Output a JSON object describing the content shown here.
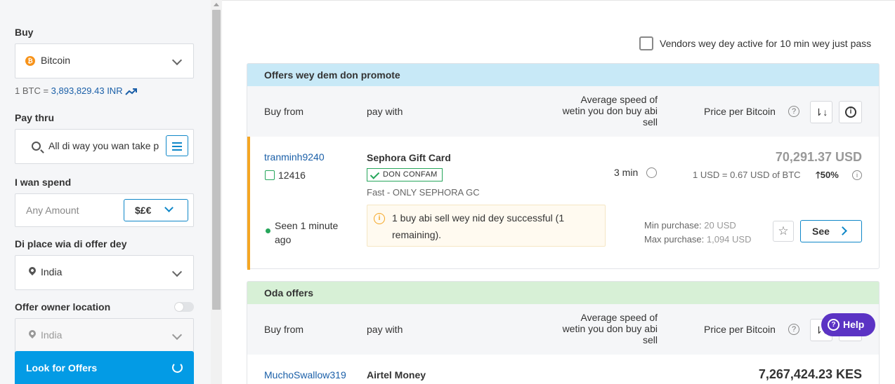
{
  "sidebar": {
    "buy_label": "Buy",
    "crypto": "Bitcoin",
    "crypto_icon": "bitcoin-icon",
    "rate_prefix": "1 BTC = ",
    "rate_value": "3,893,829.43 INR",
    "pay_label": "Pay thru",
    "pay_placeholder": "All di way you wan take p",
    "spend_label": "I wan spend",
    "amount_placeholder": "Any Amount",
    "currency_btn": "$£€",
    "location_label": "Di place wia di offer dey",
    "location_value": "India",
    "owner_location_label": "Offer owner location",
    "owner_location_value": "India",
    "look_button": "Look for Offers"
  },
  "main": {
    "active_checkbox_label": "Vendors wey dey active for 10 min wey just pass",
    "promoted": {
      "title": "Offers wey dem don promote",
      "columns": {
        "buy_from": "Buy from",
        "pay_with": "pay with",
        "speed": "Average speed of wetin you don buy abi sell",
        "price": "Price per Bitcoin"
      },
      "offer": {
        "user": "tranminh9240",
        "reputation": "12416",
        "method": "Sephora Gift Card",
        "badge": "DON CONFAM",
        "description": "Fast - ONLY SEPHORA GC",
        "speed": "3 min",
        "price": "70,291.37 USD",
        "conversion": "1 USD = 0.67 USD of BTC",
        "percent": "50%",
        "seen": "Seen 1 minute ago",
        "note": "1 buy abi sell wey nid dey successful (1 remaining).",
        "min_label": "Min purchase: ",
        "min_value": "20 USD",
        "max_label": "Max purchase: ",
        "max_value": "1,094 USD",
        "see_button": "See"
      }
    },
    "other": {
      "title": "Oda offers",
      "columns": {
        "buy_from": "Buy from",
        "pay_with": "pay with",
        "speed": "Average speed of wetin you don buy abi sell",
        "price": "Price per Bitcoin"
      },
      "offer": {
        "user": "MuchoSwallow319",
        "method": "Airtel Money",
        "price": "7,267,424.23 KES"
      }
    },
    "help_button": "Help"
  },
  "colors": {
    "promoted_header": "#c8e9f7",
    "other_header": "#d7f0d6",
    "accent": "#039be5",
    "help": "#5b33c4"
  }
}
